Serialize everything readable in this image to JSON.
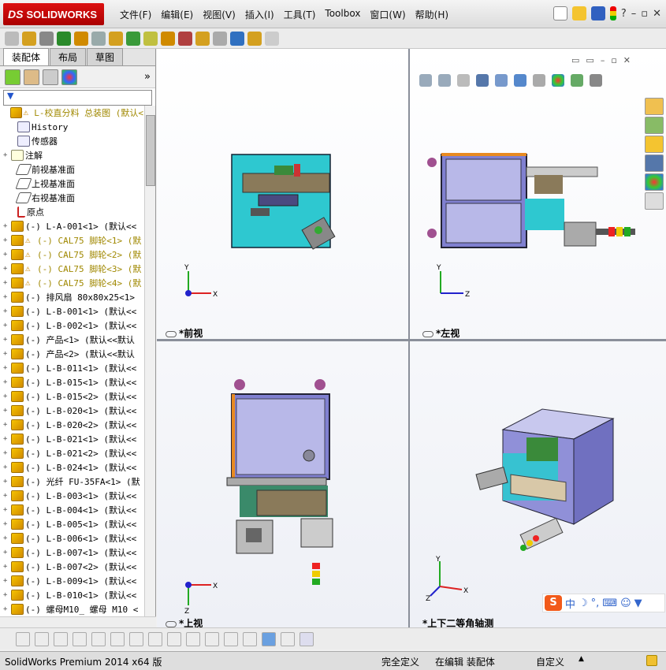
{
  "app": {
    "logo_text": "SOLIDWORKS",
    "logo_prefix": "DS"
  },
  "menu": [
    "文件(F)",
    "编辑(E)",
    "视图(V)",
    "插入(I)",
    "工具(T)",
    "Toolbox",
    "窗口(W)",
    "帮助(H)"
  ],
  "window_controls": {
    "help": "?",
    "min": "–",
    "restore": "▫",
    "close": "✕"
  },
  "panel": {
    "tabs": [
      "装配体",
      "布局",
      "草图"
    ],
    "active_tab": "装配体",
    "filter_symbol": "▼",
    "tree": [
      {
        "text": "L-校直分料 总装图 (默认<",
        "warn": true,
        "yellow": true,
        "type": "root"
      },
      {
        "text": "History",
        "type": "history"
      },
      {
        "text": "传感器",
        "type": "sensor"
      },
      {
        "text": "注解",
        "type": "annot",
        "exp": "+"
      },
      {
        "text": "前视基准面",
        "type": "plane"
      },
      {
        "text": "上视基准面",
        "type": "plane"
      },
      {
        "text": "右视基准面",
        "type": "plane"
      },
      {
        "text": "原点",
        "type": "origin"
      },
      {
        "text": "(-) L-A-001<1> (默认<<",
        "exp": "+"
      },
      {
        "text": "(-) CAL75 脚轮<1> (默",
        "exp": "+",
        "warn": true,
        "yellow": true
      },
      {
        "text": "(-) CAL75 脚轮<2> (默",
        "exp": "+",
        "warn": true,
        "yellow": true
      },
      {
        "text": "(-) CAL75 脚轮<3> (默",
        "exp": "+",
        "warn": true,
        "yellow": true
      },
      {
        "text": "(-) CAL75 脚轮<4> (默",
        "exp": "+",
        "warn": true,
        "yellow": true
      },
      {
        "text": "(-) 排风扇 80x80x25<1>",
        "exp": "+"
      },
      {
        "text": "(-) L-B-001<1> (默认<<",
        "exp": "+"
      },
      {
        "text": "(-) L-B-002<1> (默认<<",
        "exp": "+"
      },
      {
        "text": "(-) 产品<1> (默认<<默认",
        "exp": "+"
      },
      {
        "text": "(-) 产品<2> (默认<<默认",
        "exp": "+"
      },
      {
        "text": "(-) L-B-011<1> (默认<<",
        "exp": "+"
      },
      {
        "text": "(-) L-B-015<1> (默认<<",
        "exp": "+"
      },
      {
        "text": "(-) L-B-015<2> (默认<<",
        "exp": "+"
      },
      {
        "text": "(-) L-B-020<1> (默认<<",
        "exp": "+"
      },
      {
        "text": "(-) L-B-020<2> (默认<<",
        "exp": "+"
      },
      {
        "text": "(-) L-B-021<1> (默认<<",
        "exp": "+"
      },
      {
        "text": "(-) L-B-021<2> (默认<<",
        "exp": "+"
      },
      {
        "text": "(-) L-B-024<1> (默认<<",
        "exp": "+"
      },
      {
        "text": "(-) 光纤 FU-35FA<1> (默",
        "exp": "+"
      },
      {
        "text": "(-) L-B-003<1> (默认<<",
        "exp": "+"
      },
      {
        "text": "(-) L-B-004<1> (默认<<",
        "exp": "+"
      },
      {
        "text": "(-) L-B-005<1> (默认<<",
        "exp": "+"
      },
      {
        "text": "(-) L-B-006<1> (默认<<",
        "exp": "+"
      },
      {
        "text": "(-) L-B-007<1> (默认<<",
        "exp": "+"
      },
      {
        "text": "(-) L-B-007<2> (默认<<",
        "exp": "+"
      },
      {
        "text": "(-) L-B-009<1> (默认<<",
        "exp": "+"
      },
      {
        "text": "(-) L-B-010<1> (默认<<",
        "exp": "+"
      },
      {
        "text": "(-) 螺母M10_ 螺母 M10 <",
        "exp": "+"
      }
    ]
  },
  "views": {
    "front": "*前视",
    "left": "*左视",
    "top": "*上视",
    "iso": "*上下二等角轴测"
  },
  "triad": {
    "x": "X",
    "y": "Y",
    "z": "Z"
  },
  "ime": {
    "logo": "S",
    "lang": "中",
    "punct": "°,"
  },
  "status": {
    "product": "SolidWorks Premium 2014 x64 版",
    "defined": "完全定义",
    "editing": "在编辑 装配体",
    "units": "自定义",
    "arrow": "▲"
  },
  "colors": {
    "accent": "#c8102e",
    "tree_yellow": "#a08800",
    "view_bg": "#ffffff"
  }
}
